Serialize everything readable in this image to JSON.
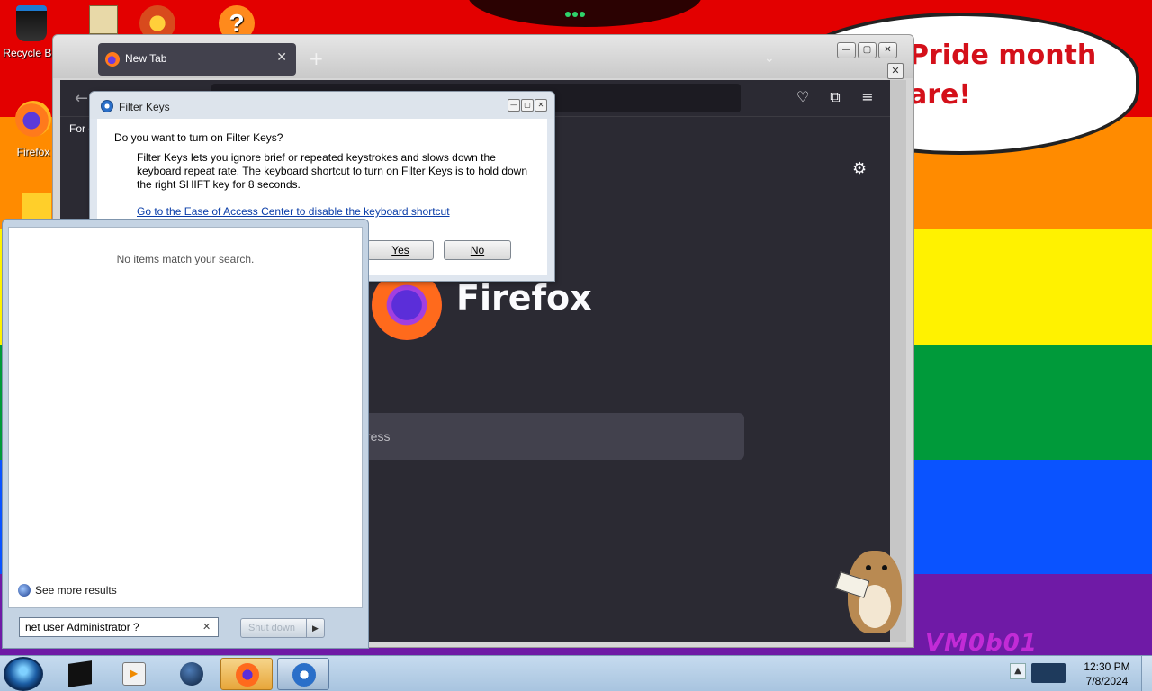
{
  "desktop": {
    "icons": [
      {
        "label": "Recycle Bin",
        "icon": "recycle-bin-icon"
      },
      {
        "label": "Firefox",
        "icon": "firefox-icon"
      }
    ],
    "bubble_text": "Pride month\nare!",
    "watermark": "VM0b01",
    "stripe_colors": [
      "#e30000",
      "#ff8b00",
      "#fff200",
      "#009a3a",
      "#0a53ff",
      "#6f1aa6"
    ]
  },
  "firefox": {
    "tab_title": "New Tab",
    "bookmark_bar_text": "For q",
    "brand": "Firefox",
    "search_placeholder": "ress"
  },
  "dialog": {
    "title": "Filter Keys",
    "question": "Do you want to turn on Filter Keys?",
    "description": "Filter Keys lets you ignore brief or repeated keystrokes and slows down the keyboard repeat rate.  The keyboard shortcut to turn on Filter Keys is to hold down the right SHIFT key for 8 seconds.",
    "link": "Go to the Ease of Access Center to disable the keyboard shortcut",
    "yes_label": "Yes",
    "no_label": "No"
  },
  "start_menu": {
    "no_results": "No items match your search.",
    "see_more": "See more results",
    "search_value": "net user Administrator ?",
    "shutdown_label": "Shut down"
  },
  "taskbar": {
    "apps": [
      "explorer-icon",
      "media-player-icon",
      "globe-icon",
      "firefox-icon",
      "ease-of-access-icon"
    ],
    "time": "12:30 PM",
    "date": "7/8/2024"
  }
}
